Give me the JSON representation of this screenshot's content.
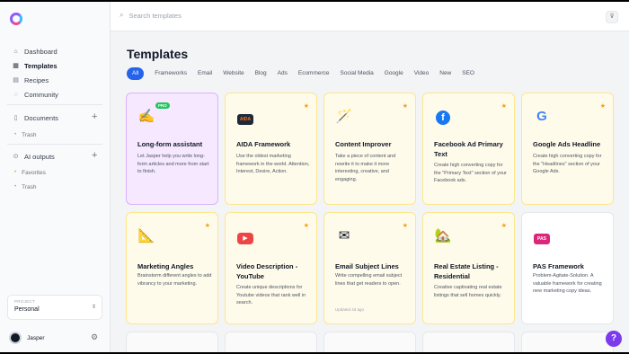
{
  "sidebar": {
    "nav": [
      "Dashboard",
      "Templates",
      "Recipes",
      "Community"
    ],
    "documents": "Documents",
    "documents_sub": [
      "Trash"
    ],
    "ai_outputs": "AI outputs",
    "ai_outputs_sub": [
      "Favorites",
      "Trash"
    ],
    "project_label": "PROJECT",
    "project_value": "Personal",
    "user": "Jasper"
  },
  "search": {
    "placeholder": "Search templates"
  },
  "page_title": "Templates",
  "filters": [
    "All",
    "Frameworks",
    "Email",
    "Website",
    "Blog",
    "Ads",
    "Ecommerce",
    "Social Media",
    "Google",
    "Video",
    "New",
    "SEO"
  ],
  "cards": [
    {
      "title": "Long-form assistant",
      "desc": "Let Jasper help you write long-form articles and more from start to finish.",
      "badge": "PRO",
      "icon": "pen-icon"
    },
    {
      "title": "AIDA Framework",
      "desc": "Use the oldest marketing framework in the world. Attention, Interest, Desire, Action.",
      "icon_text": "AIDA"
    },
    {
      "title": "Content Improver",
      "desc": "Take a piece of content and rewrite it to make it more interesting, creative, and engaging.",
      "icon": "wand-icon"
    },
    {
      "title": "Facebook Ad Primary Text",
      "desc": "Create high converting copy for the \"Primary Text\" section of your Facebook ads.",
      "icon_text": "f"
    },
    {
      "title": "Google Ads Headline",
      "desc": "Create high converting copy for the \"Headlines\" section of your Google Ads.",
      "icon_text": "G"
    },
    {
      "title": "Marketing Angles",
      "desc": "Brainstorm different angles to add vibrancy to your marketing.",
      "icon": "ruler-icon"
    },
    {
      "title": "Video Description - YouTube",
      "desc": "Create unique descriptions for Youtube videos that rank well in search.",
      "icon_text": "▶"
    },
    {
      "title": "Email Subject Lines",
      "desc": "Write compelling email subject lines that get readers to open.",
      "meta": "Updated 4d ago",
      "icon": "envelope-icon"
    },
    {
      "title": "Real Estate Listing - Residential",
      "desc": "Creative captivating real estate listings that sell homes quickly.",
      "icon": "house-icon"
    },
    {
      "title": "PAS Framework",
      "desc": "Problem-Agitate-Solution. A valuable framework for creating new marketing copy ideas.",
      "icon_text": "PAS"
    }
  ],
  "help_button": "?"
}
